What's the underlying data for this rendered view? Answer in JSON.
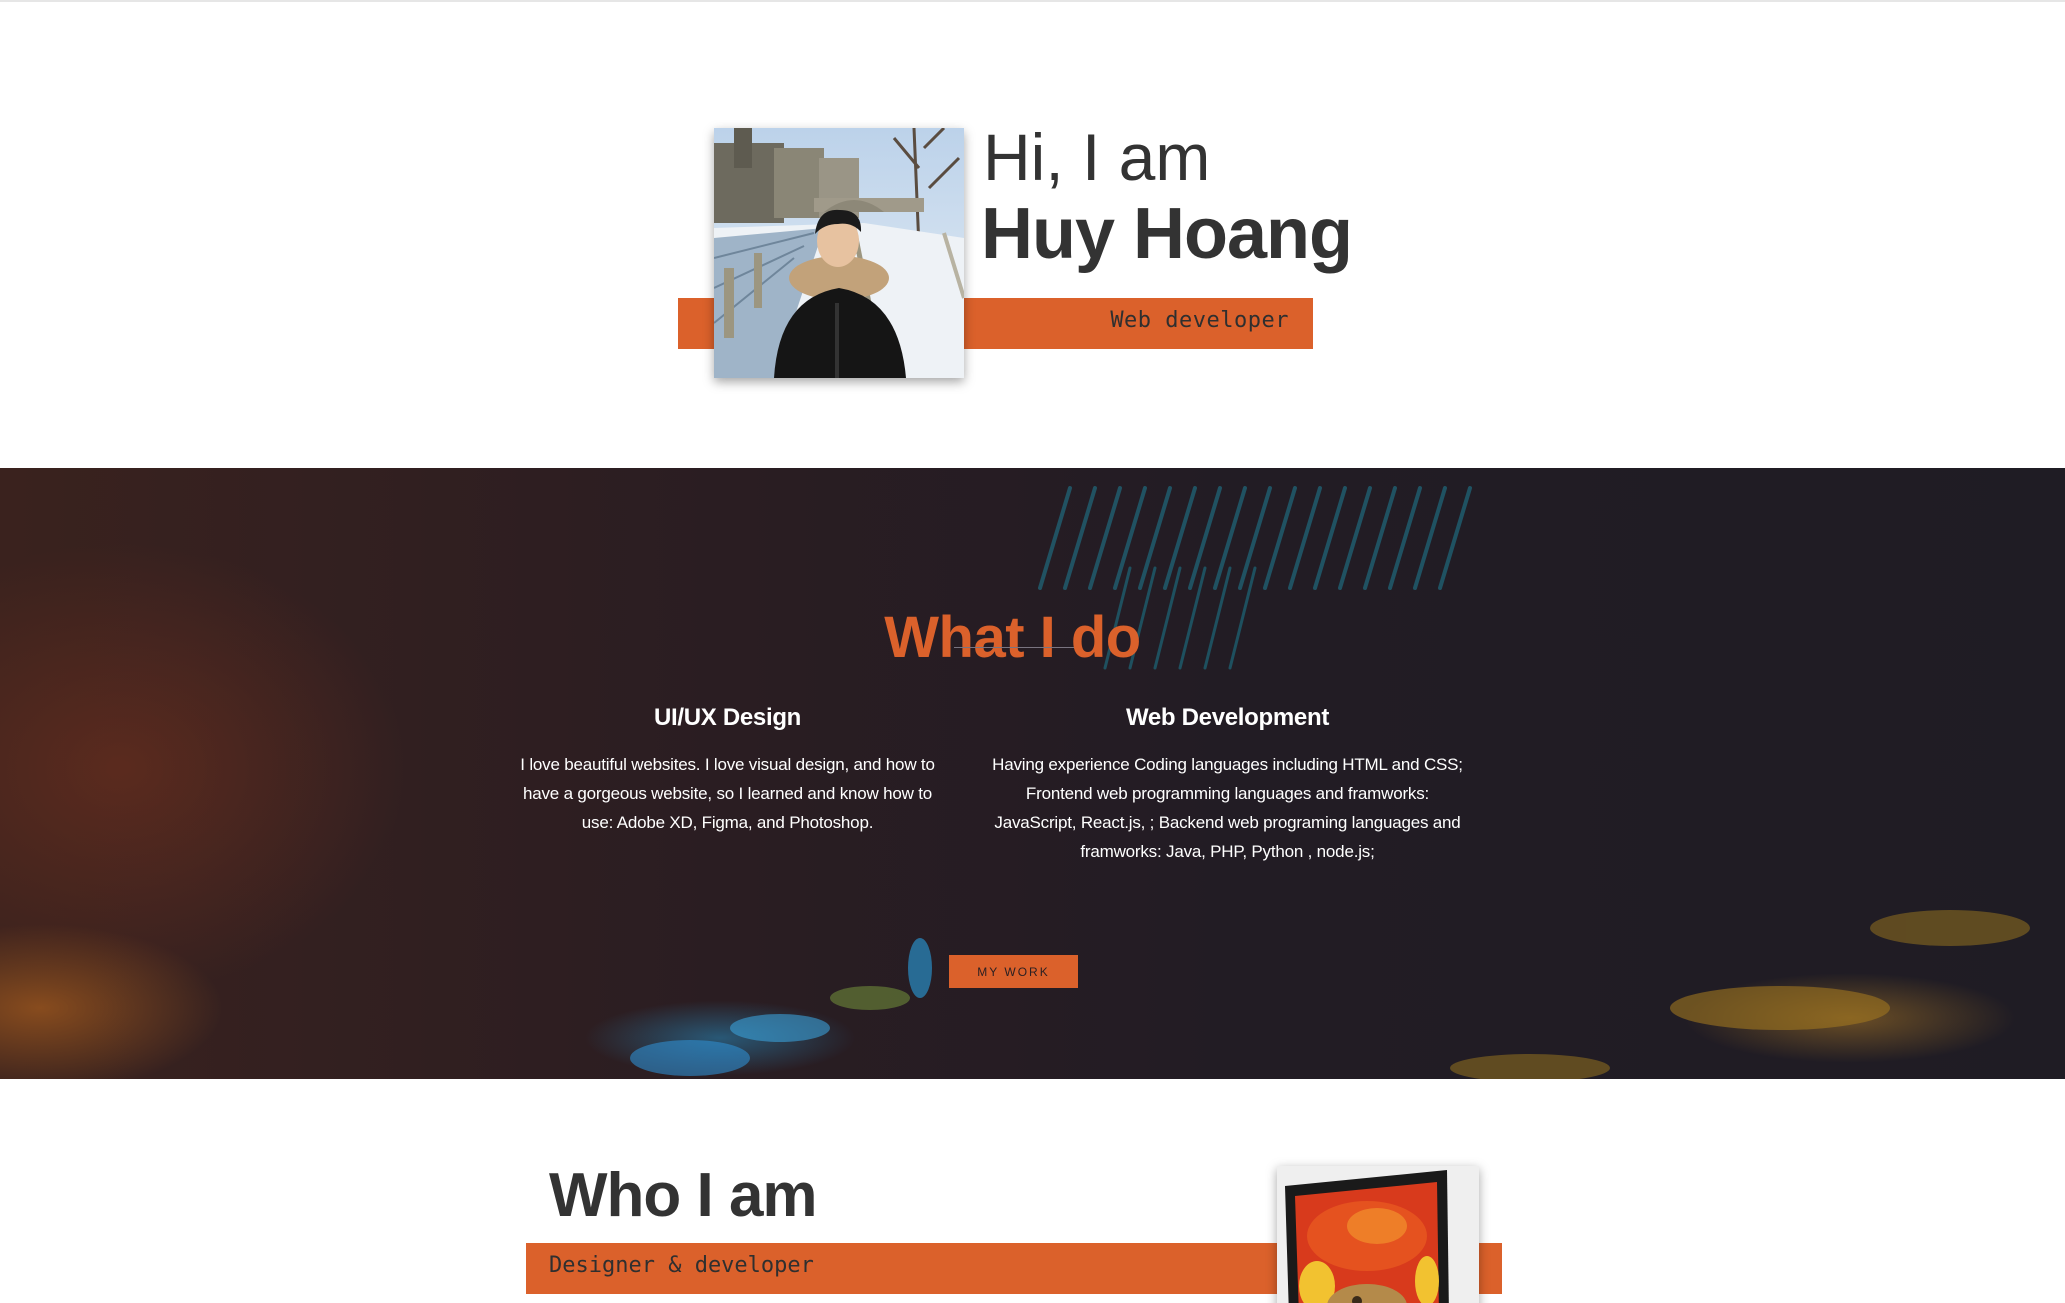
{
  "hero": {
    "greeting": "Hi, I am",
    "name": "Huy Hoang",
    "role": "Web developer",
    "photo_alt": "Portrait photo in snowy city"
  },
  "services": {
    "title": "What I do",
    "items": [
      {
        "heading": "UI/UX Design",
        "text": "I love beautiful websites. I love visual design, and how to have a gorgeous website, so I learned and know how to use: Adobe XD, Figma, and Photoshop."
      },
      {
        "heading": "Web Development",
        "text": "Having experience Coding languages including HTML and CSS; Frontend web programming languages and framworks: JavaScript, React.js, ; Backend web programing languages and framworks: Java, PHP, Python , node.js;"
      }
    ],
    "button_label": "MY WORK"
  },
  "about": {
    "title": "Who I am",
    "role": "Designer & developer"
  },
  "colors": {
    "accent": "#db612b",
    "text_dark": "#333333",
    "section_dark": "#221c24"
  }
}
